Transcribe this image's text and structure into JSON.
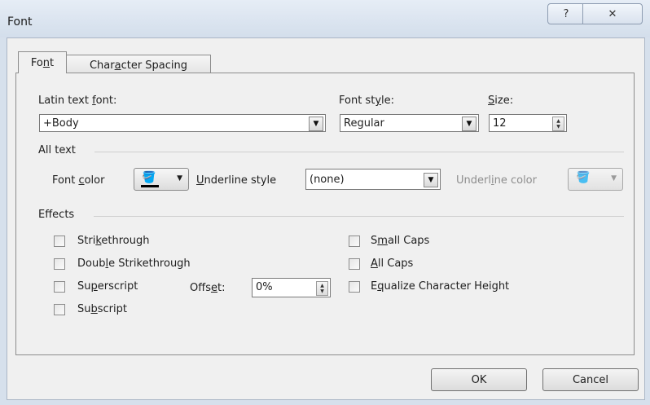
{
  "window": {
    "title": "Font",
    "help_icon": "?",
    "close_icon": "✕"
  },
  "tabs": [
    {
      "label_pre": "Fo",
      "label_key": "n",
      "label_post": "t",
      "active": true
    },
    {
      "label_pre": "Char",
      "label_key": "a",
      "label_post": "cter Spacing",
      "active": false
    }
  ],
  "font": {
    "latin_label_pre": "Latin text ",
    "latin_label_key": "f",
    "latin_label_post": "ont:",
    "latin_value": "+Body",
    "style_label_pre": "Font st",
    "style_label_key": "y",
    "style_label_post": "le:",
    "style_value": "Regular",
    "size_label_key": "S",
    "size_label_post": "ize:",
    "size_value": "12"
  },
  "all_text": {
    "group_label": "All text",
    "color_label_pre": "Font ",
    "color_label_key": "c",
    "color_label_post": "olor",
    "font_color": "#000000",
    "underline_style_label_key": "U",
    "underline_style_label_post": "nderline style",
    "underline_style_value": "(none)",
    "underline_color_label_pre": "Underl",
    "underline_color_label_key": "i",
    "underline_color_label_post": "ne color"
  },
  "effects": {
    "group_label": "Effects",
    "strikethrough": {
      "pre": "Stri",
      "key": "k",
      "post": "ethrough",
      "checked": false
    },
    "double_strikethrough": {
      "pre": "Doub",
      "key": "l",
      "post": "e Strikethrough",
      "checked": false
    },
    "superscript": {
      "pre": "Su",
      "key": "p",
      "post": "erscript",
      "checked": false
    },
    "subscript": {
      "pre": "Su",
      "key": "b",
      "post": "script",
      "checked": false
    },
    "offset_label_pre": "Offs",
    "offset_label_key": "e",
    "offset_label_post": "t:",
    "offset_value": "0%",
    "small_caps": {
      "pre": "S",
      "key": "m",
      "post": "all Caps",
      "checked": false
    },
    "all_caps": {
      "pre": "",
      "key": "A",
      "post": "ll Caps",
      "checked": false
    },
    "equalize": {
      "pre": "E",
      "key": "q",
      "post": "ualize Character Height",
      "checked": false
    }
  },
  "buttons": {
    "ok": "OK",
    "cancel": "Cancel"
  }
}
